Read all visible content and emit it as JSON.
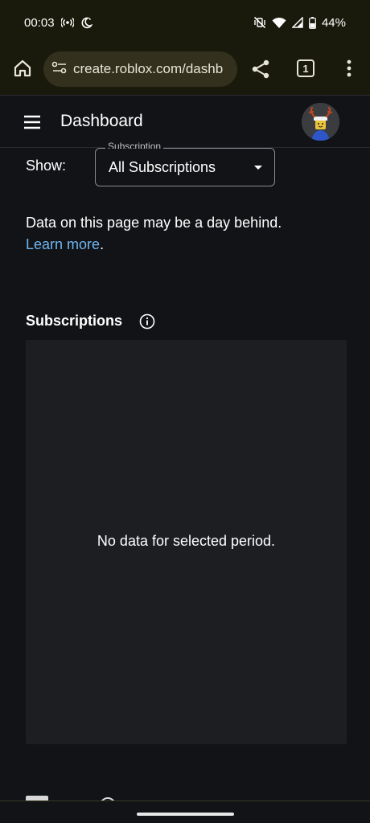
{
  "status_bar": {
    "time": "00:03",
    "battery": "44%",
    "icons": [
      "hotspot-icon",
      "dnd-moon-icon",
      "mute-vibrate-icon",
      "wifi-icon",
      "signal-icon",
      "battery-icon"
    ]
  },
  "browser": {
    "url": "create.roblox.com/dashb",
    "tab_count": "1",
    "icons": [
      "home-icon",
      "site-settings-icon",
      "share-icon",
      "more-vert-icon"
    ]
  },
  "header": {
    "title": "Dashboard",
    "icons": [
      "hamburger-menu-icon",
      "avatar"
    ]
  },
  "filters": {
    "show_label": "Show:",
    "select_legend": "Subscription",
    "select_value": "All Subscriptions"
  },
  "notice": {
    "text": "Data on this page may be a day behind.",
    "link": "Learn more",
    "suffix": "."
  },
  "subscriptions_section": {
    "title": "Subscriptions",
    "empty_message": "No data for selected period."
  },
  "colors": {
    "background": "#121316",
    "status_bar_bg": "#1a1a0c",
    "url_pill_bg": "#33301d",
    "panel_bg": "#1d1e22",
    "link": "#6fb6f2",
    "text": "#ffffff"
  }
}
